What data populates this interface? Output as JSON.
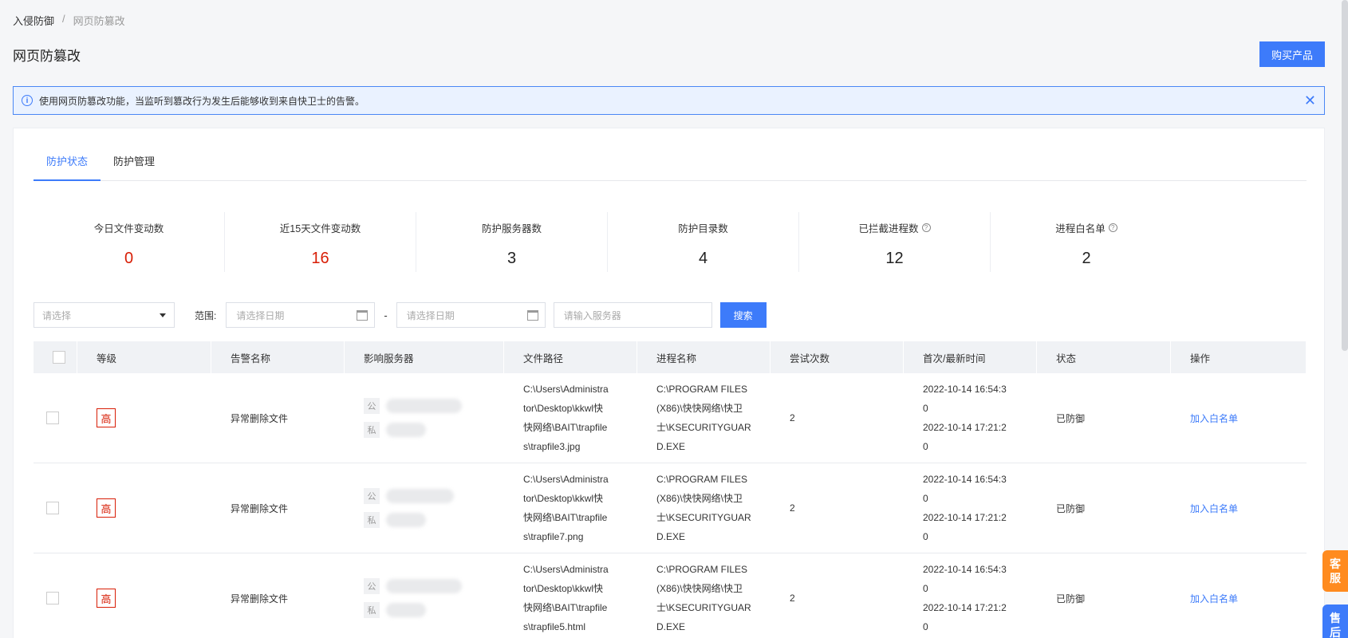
{
  "breadcrumb": {
    "parent": "入侵防御",
    "separator": "/",
    "current": "网页防篡改"
  },
  "page": {
    "title": "网页防篡改",
    "buy_label": "购买产品"
  },
  "alert": {
    "text": "使用网页防篡改功能，当监听到篡改行为发生后能够收到来自快卫士的告警。",
    "close_glyph": "✕"
  },
  "tabs": [
    {
      "label": "防护状态",
      "active": true
    },
    {
      "label": "防护管理",
      "active": false
    }
  ],
  "stats": [
    {
      "label": "今日文件变动数",
      "value": "0",
      "highlight": true,
      "help": false
    },
    {
      "label": "近15天文件变动数",
      "value": "16",
      "highlight": true,
      "help": false
    },
    {
      "label": "防护服务器数",
      "value": "3",
      "highlight": false,
      "help": false
    },
    {
      "label": "防护目录数",
      "value": "4",
      "highlight": false,
      "help": false
    },
    {
      "label": "已拦截进程数",
      "value": "12",
      "highlight": false,
      "help": true
    },
    {
      "label": "进程白名单",
      "value": "2",
      "highlight": false,
      "help": true
    }
  ],
  "filters": {
    "select_placeholder": "请选择",
    "range_label": "范围:",
    "start_date_placeholder": "请选择日期",
    "dash": "-",
    "end_date_placeholder": "请选择日期",
    "server_placeholder": "请输入服务器",
    "search_label": "搜索"
  },
  "table": {
    "headers": [
      "等级",
      "告警名称",
      "影响服务器",
      "文件路径",
      "进程名称",
      "尝试次数",
      "首次/最新时间",
      "状态",
      "操作"
    ],
    "server_tags": {
      "public": "公",
      "private": "私"
    },
    "rows": [
      {
        "level": "高",
        "alert_name": "异常删除文件",
        "file_path": "C:\\Users\\Administra\ntor\\Desktop\\kkwl快\n快网络\\BAIT\\trapfile\ns\\trapfile3.jpg",
        "process": "C:\\PROGRAM FILES\n(X86)\\快快网络\\快卫\n士\\KSECURITYGUAR\nD.EXE",
        "attempts": "2",
        "times": "2022-10-14 16:54:3\n0\n2022-10-14 17:21:2\n0",
        "status": "已防御",
        "action": "加入白名单"
      },
      {
        "level": "高",
        "alert_name": "异常删除文件",
        "file_path": "C:\\Users\\Administra\ntor\\Desktop\\kkwl快\n快网络\\BAIT\\trapfile\ns\\trapfile7.png",
        "process": "C:\\PROGRAM FILES\n(X86)\\快快网络\\快卫\n士\\KSECURITYGUAR\nD.EXE",
        "attempts": "2",
        "times": "2022-10-14 16:54:3\n0\n2022-10-14 17:21:2\n0",
        "status": "已防御",
        "action": "加入白名单"
      },
      {
        "level": "高",
        "alert_name": "异常删除文件",
        "file_path": "C:\\Users\\Administra\ntor\\Desktop\\kkwl快\n快网络\\BAIT\\trapfile\ns\\trapfile5.html",
        "process": "C:\\PROGRAM FILES\n(X86)\\快快网络\\快卫\n士\\KSECURITYGUAR\nD.EXE",
        "attempts": "2",
        "times": "2022-10-14 16:54:3\n0\n2022-10-14 17:21:2\n0",
        "status": "已防御",
        "action": "加入白名单"
      }
    ]
  },
  "side": {
    "service": "客\n服",
    "aftersale": "售\n后"
  },
  "colors": {
    "accent": "#3d7bfa",
    "danger": "#d81e06",
    "side_orange": "#ff8b1f"
  }
}
